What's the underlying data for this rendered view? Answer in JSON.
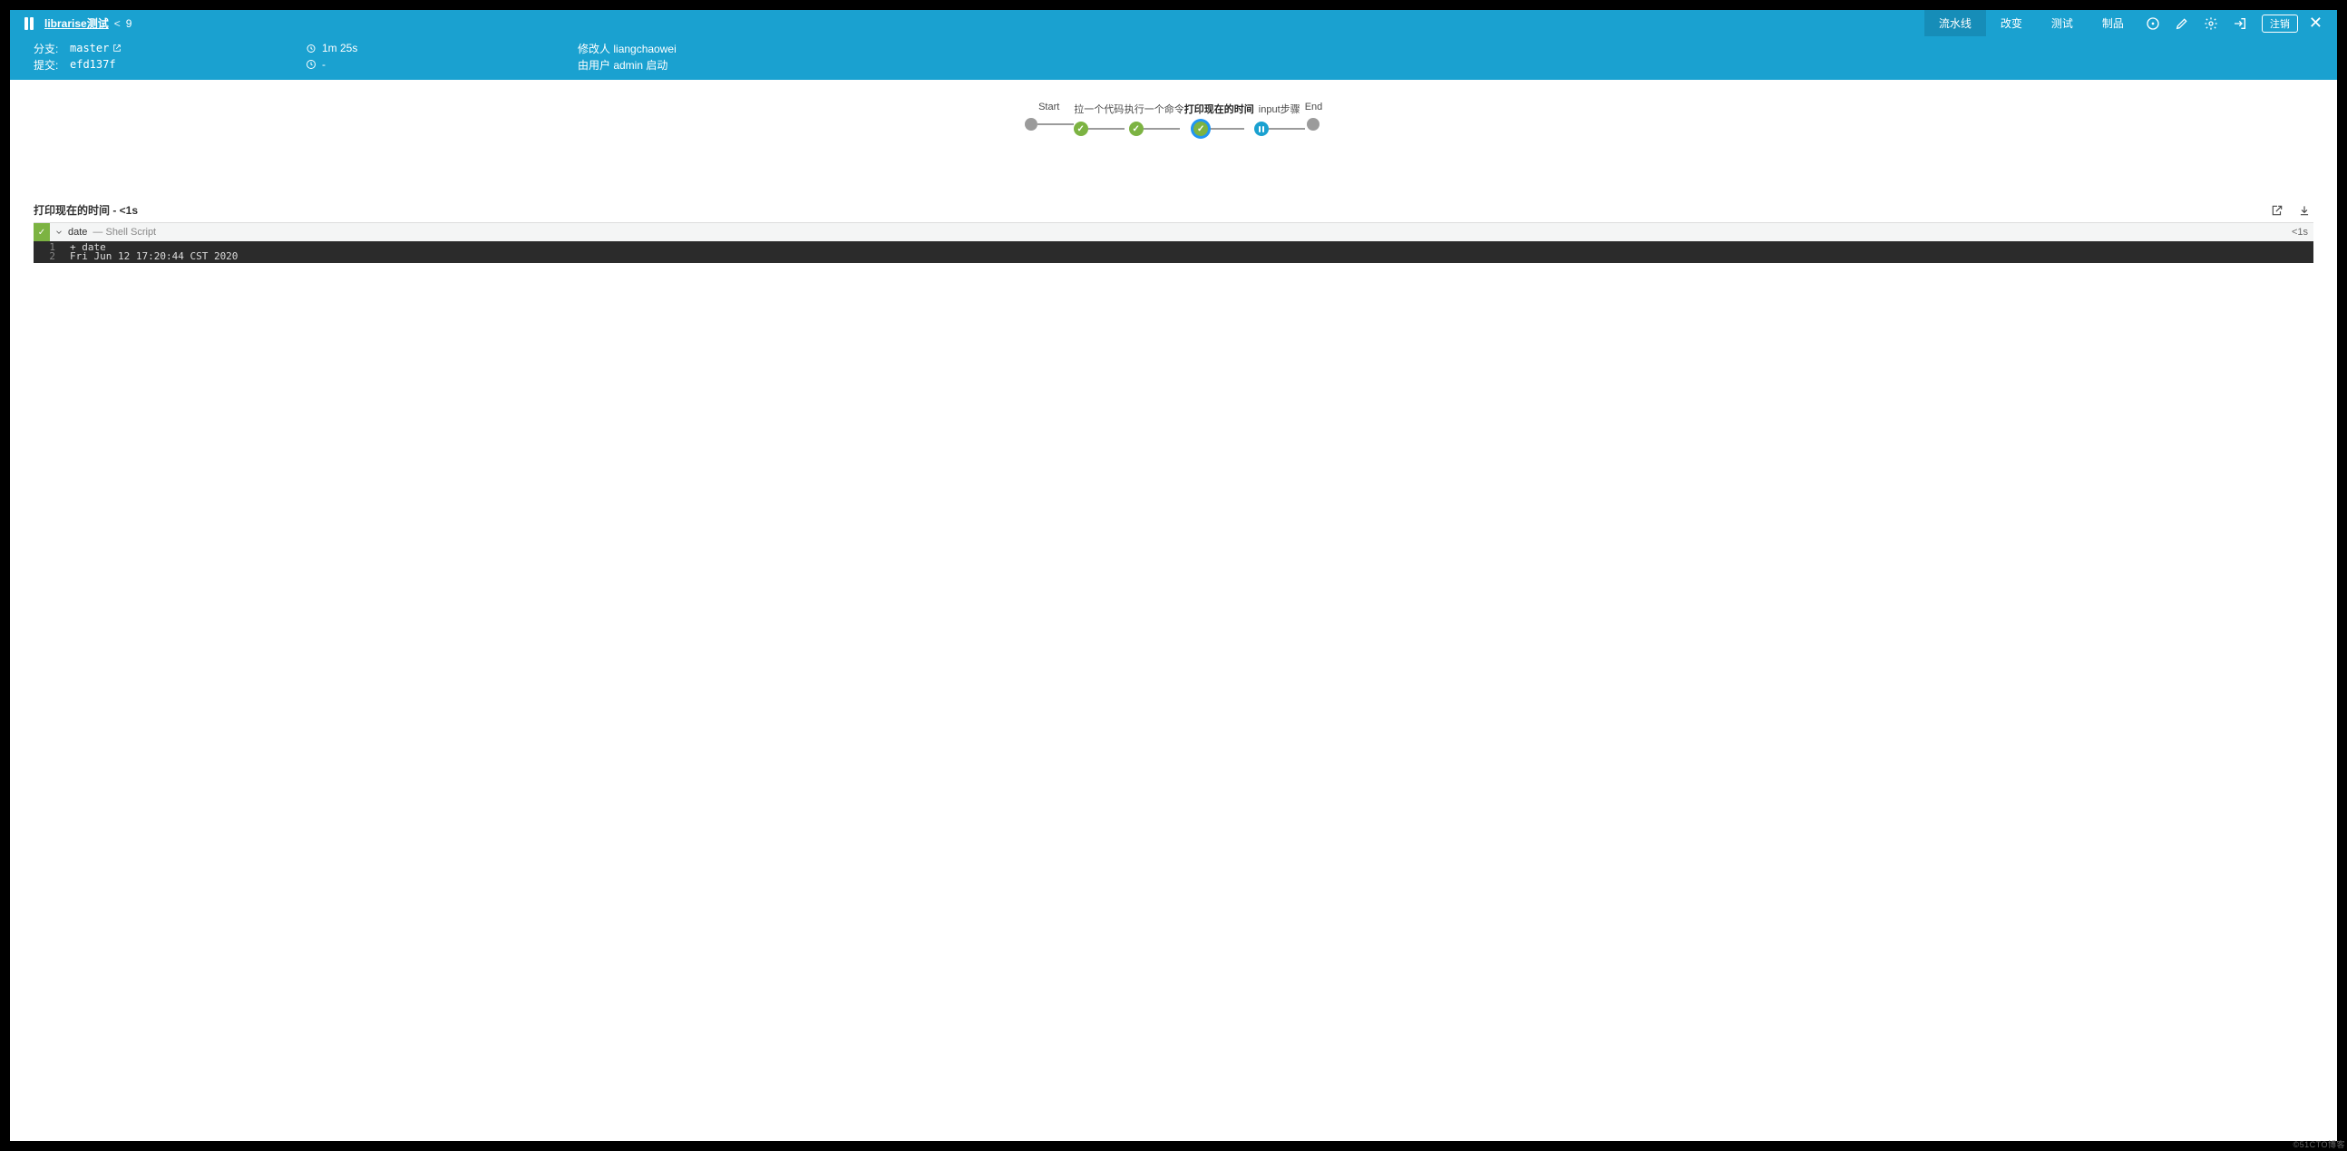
{
  "header": {
    "title": "librarise测试",
    "run_number": "9",
    "tabs": [
      {
        "id": "pipeline",
        "label": "流水线",
        "active": true
      },
      {
        "id": "changes",
        "label": "改变",
        "active": false
      },
      {
        "id": "tests",
        "label": "测试",
        "active": false
      },
      {
        "id": "artifacts",
        "label": "制品",
        "active": false
      }
    ],
    "logout_label": "注销"
  },
  "run_info": {
    "branch_label": "分支:",
    "branch_value": "master",
    "commit_label": "提交:",
    "commit_value": "efd137f",
    "duration_value": "1m 25s",
    "changed_value": "-",
    "changed_by_label": "修改人",
    "changed_by_value": "liangchaowei",
    "started_by_text": "由用户 admin 启动"
  },
  "pipeline": {
    "stages": [
      {
        "id": "start",
        "label": "Start",
        "kind": "dot"
      },
      {
        "id": "pull",
        "label": "拉一个代码",
        "kind": "success"
      },
      {
        "id": "exec",
        "label": "执行一个命令",
        "kind": "success"
      },
      {
        "id": "print",
        "label": "打印现在的时间",
        "kind": "success",
        "selected": true
      },
      {
        "id": "input",
        "label": "input步骤",
        "kind": "pause"
      },
      {
        "id": "end",
        "label": "End",
        "kind": "dot"
      }
    ]
  },
  "step_section": {
    "title": "打印现在的时间 - <1s"
  },
  "steps": [
    {
      "name": "date",
      "description": "— Shell Script",
      "duration": "<1s",
      "status": "success",
      "console": [
        {
          "n": "1",
          "text": "+ date"
        },
        {
          "n": "2",
          "text": "Fri Jun 12 17:20:44 CST 2020"
        }
      ]
    }
  ],
  "watermark": "©51CTO博客"
}
